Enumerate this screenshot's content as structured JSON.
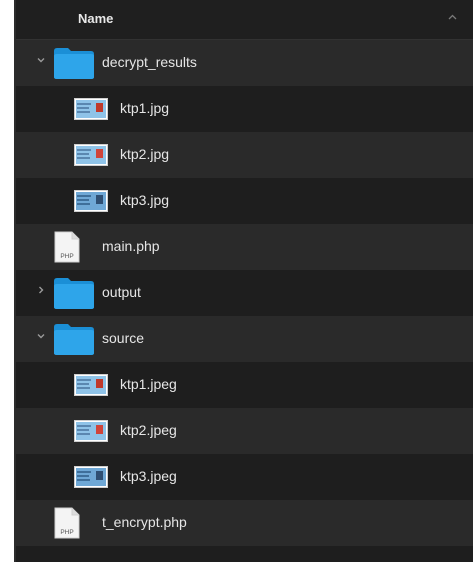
{
  "header": {
    "column_name": "Name",
    "sort_icon": "chevron-up-icon"
  },
  "rows": [
    {
      "name": "decrypt_results",
      "type": "folder",
      "expanded": true
    },
    {
      "name": "ktp1.jpg",
      "type": "image"
    },
    {
      "name": "ktp2.jpg",
      "type": "image"
    },
    {
      "name": "ktp3.jpg",
      "type": "image"
    },
    {
      "name": "main.php",
      "type": "php"
    },
    {
      "name": "output",
      "type": "folder",
      "expanded": false
    },
    {
      "name": "source",
      "type": "folder",
      "expanded": true
    },
    {
      "name": "ktp1.jpeg",
      "type": "image"
    },
    {
      "name": "ktp2.jpeg",
      "type": "image"
    },
    {
      "name": "ktp3.jpeg",
      "type": "image"
    },
    {
      "name": "t_encrypt.php",
      "type": "php"
    }
  ],
  "php_badge": "PHP",
  "colors": {
    "folder": "#2ea5ea",
    "folder_dark": "#1b8fd6",
    "background": "#1e1e1e",
    "row_alt": "#2a2a2a",
    "text": "#e6e6e6"
  }
}
